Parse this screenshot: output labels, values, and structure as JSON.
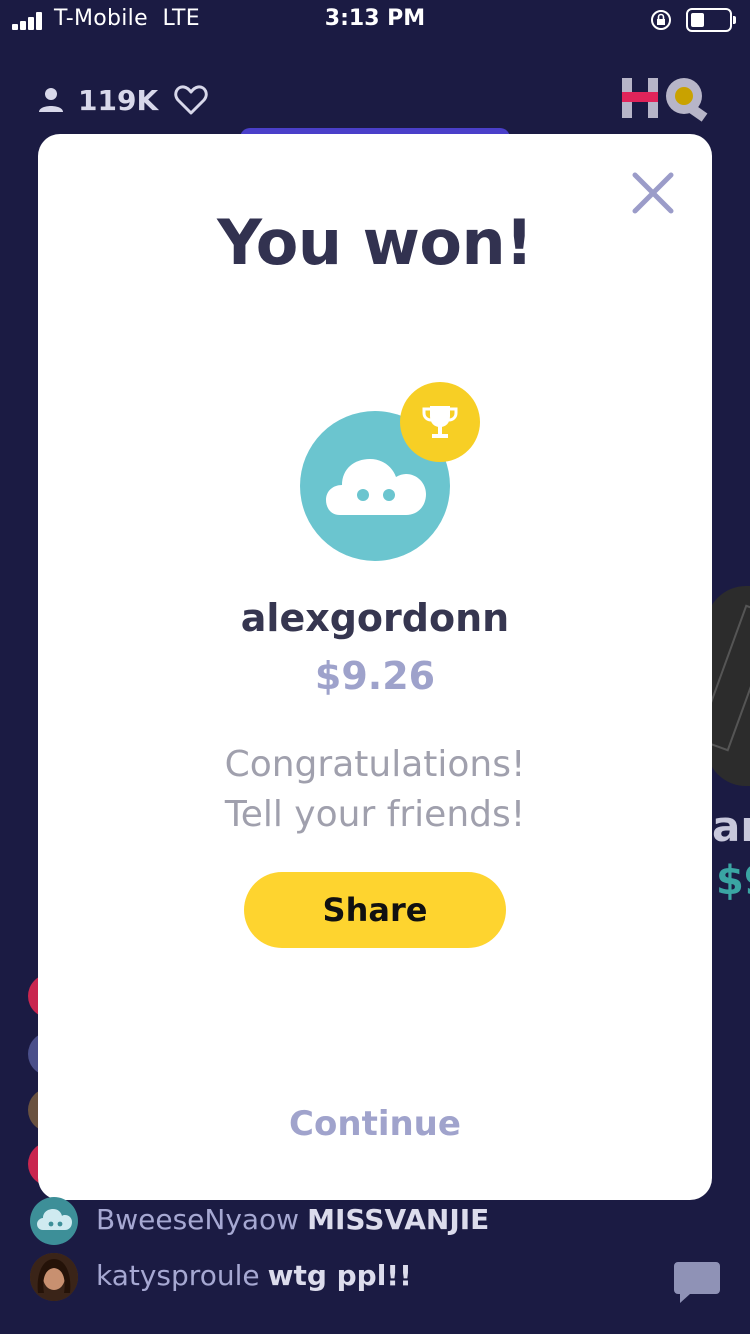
{
  "status_bar": {
    "carrier": "T-Mobile",
    "network": "LTE",
    "time": "3:13 PM",
    "battery_fraction": 0.35
  },
  "header": {
    "viewer_count": "119K",
    "logo_icon": "hq-logo"
  },
  "background_peek": {
    "side_text_1": "ar",
    "side_text_2": "$9"
  },
  "modal": {
    "title": "You won!",
    "username": "alexgordonn",
    "amount": "$9.26",
    "congrats_line1": "Congratulations!",
    "congrats_line2": "Tell your friends!",
    "share_label": "Share",
    "continue_label": "Continue",
    "avatar_icon": "cloud-avatar-icon",
    "badge_icon": "trophy-icon",
    "close_icon": "close-icon"
  },
  "chat": [
    {
      "user": "BweeseNyaow",
      "message": "MISSVANJIE"
    },
    {
      "user": "katysproule",
      "message": "wtg ppl!!"
    }
  ],
  "colors": {
    "background": "#1b1b43",
    "accent_yellow": "#fed42f",
    "avatar_teal": "#6bc5cf",
    "amount_lavender": "#9ea2cb"
  }
}
